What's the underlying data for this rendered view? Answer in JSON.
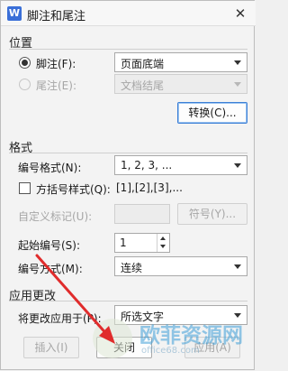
{
  "window": {
    "title": "脚注和尾注",
    "app_icon": "W",
    "close_glyph": "✕"
  },
  "position": {
    "heading": "位置",
    "footnote": {
      "label": "脚注(F):",
      "checked": true,
      "value": "页面底端"
    },
    "endnote": {
      "label": "尾注(E):",
      "checked": false,
      "value": "文档结尾"
    },
    "convert_button": "转换(C)..."
  },
  "format": {
    "heading": "格式",
    "number_format": {
      "label": "编号格式(N):",
      "value": "1, 2, 3, ..."
    },
    "bracket_style": {
      "label": "方括号样式(Q):",
      "checked": false,
      "sample": "[1],[2],[3],..."
    },
    "custom_mark": {
      "label": "自定义标记(U):",
      "value": "",
      "symbol_button": "符号(Y)..."
    },
    "start_at": {
      "label": "起始编号(S):",
      "value": "1"
    },
    "numbering": {
      "label": "编号方式(M):",
      "value": "连续"
    }
  },
  "apply": {
    "heading": "应用更改",
    "apply_to": {
      "label": "将更改应用于(P):",
      "value": "所选文字"
    }
  },
  "footer": {
    "insert": "插入(I)",
    "close": "关闭",
    "apply": "应用(A)"
  },
  "watermark": {
    "text": "欧菲资源网",
    "sub": "office68.com"
  },
  "colors": {
    "accent_arrow": "#e02c2c",
    "primary_border": "#3c7fd6"
  }
}
